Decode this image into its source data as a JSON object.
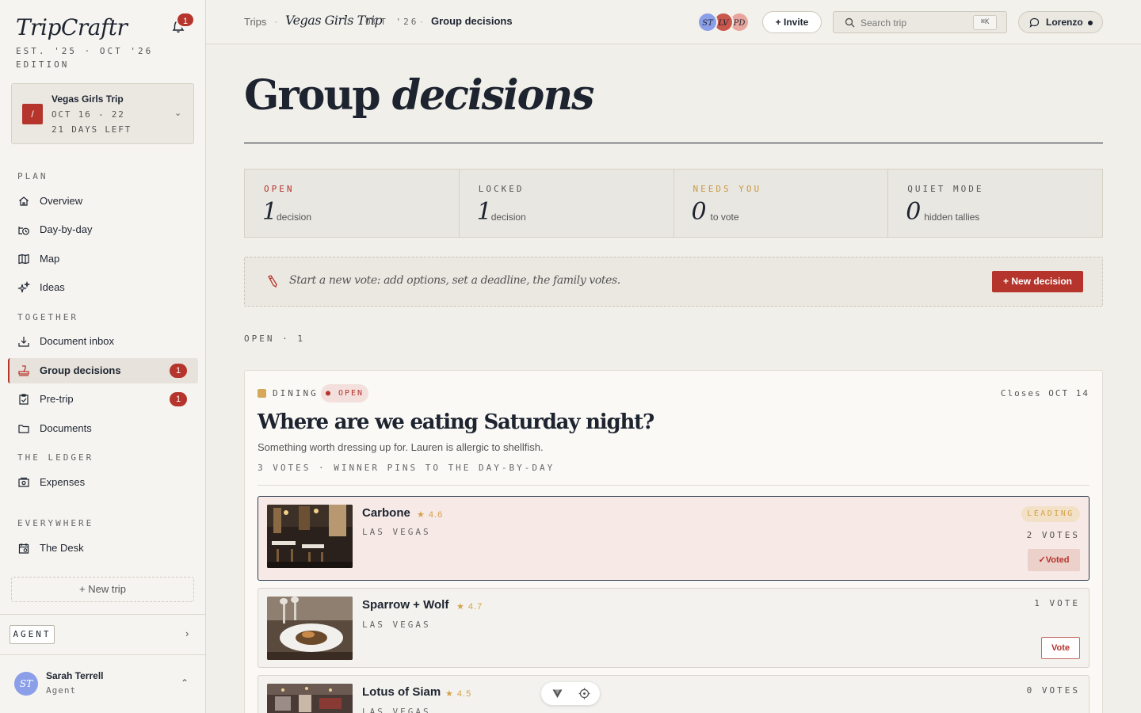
{
  "brand": {
    "name": "TripCraftr",
    "subtitle": "EST. '25 · OCT '26 EDITION",
    "notification_count": "1"
  },
  "trip": {
    "stamp": "/",
    "name": "Vegas Girls Trip",
    "dates": "OCT 16 - 22",
    "days_left": "21 DAYS LEFT"
  },
  "nav": {
    "plan_label": "PLAN",
    "together_label": "TOGETHER",
    "ledger_label": "THE LEDGER",
    "everywhere_label": "EVERYWHERE",
    "overview": "Overview",
    "day_by_day": "Day-by-day",
    "map": "Map",
    "ideas": "Ideas",
    "document_inbox": "Document inbox",
    "group_decisions": "Group decisions",
    "group_decisions_badge": "1",
    "pre_trip": "Pre-trip",
    "pre_trip_badge": "1",
    "documents": "Documents",
    "expenses": "Expenses",
    "the_desk": "The Desk",
    "new_trip": "+ New trip"
  },
  "agent": {
    "label": "AGENT"
  },
  "user": {
    "initials": "ST",
    "name": "Sarah Terrell",
    "role": "Agent"
  },
  "topbar": {
    "crumb_trips": "Trips",
    "crumb_trip": "Vegas Girls Trip",
    "crumb_date": "OCT '26",
    "crumb_current": "Group decisions",
    "avatars": [
      "ST",
      "LV",
      "PD"
    ],
    "invite": "+ Invite",
    "search_placeholder": "Search trip",
    "search_kbd": "⌘K",
    "user_button": "Lorenzo"
  },
  "page": {
    "title_plain": "Group ",
    "title_italic": "decisions"
  },
  "stats": [
    {
      "label": "OPEN",
      "value": "1",
      "text": "decision"
    },
    {
      "label": "LOCKED",
      "value": "1",
      "text": "decision"
    },
    {
      "label": "NEEDS YOU",
      "value": "0",
      "text": "to vote"
    },
    {
      "label": "QUIET MODE",
      "value": "0",
      "text": "hidden tallies"
    }
  ],
  "new_vote": {
    "prompt": "Start a new vote: add options, set a deadline, the family votes.",
    "button": "+ New decision"
  },
  "open_section": "OPEN · 1",
  "decision": {
    "category": "DINING",
    "status": "● OPEN",
    "closes": "Closes OCT 14",
    "question": "Where are we eating Saturday night?",
    "description": "Something worth dressing up for. Lauren is allergic to shellfish.",
    "meta": "3 VOTES · WINNER PINS TO THE DAY-BY-DAY",
    "options": [
      {
        "name": "Carbone",
        "rating": "★ 4.6",
        "city": "LAS VEGAS",
        "badge": "LEADING",
        "votes": "2 VOTES",
        "action": "✓Voted"
      },
      {
        "name": "Sparrow + Wolf",
        "rating": "★ 4.7",
        "city": "LAS VEGAS",
        "votes": "1 VOTE",
        "action": "Vote"
      },
      {
        "name": "Lotus of Siam",
        "rating": "★ 4.5",
        "city": "LAS VEGAS",
        "votes": "0 VOTES"
      }
    ]
  },
  "colors": {
    "accent": "#b5342c",
    "gold": "#d4a24a",
    "ink": "#1d2430",
    "paper": "#f1efea"
  }
}
